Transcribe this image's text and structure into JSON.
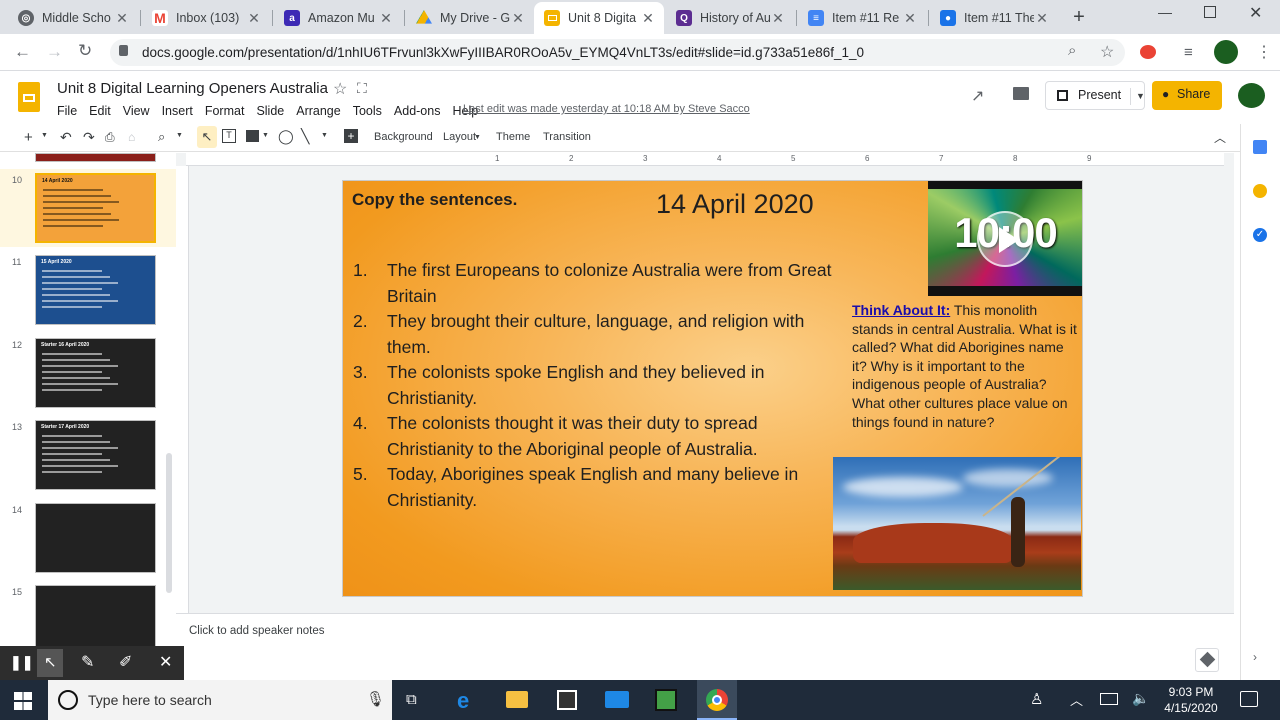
{
  "tabs": [
    {
      "label": "Middle Scho",
      "color": "#5f6368"
    },
    {
      "label": "Inbox (103)",
      "color": "#ea4335"
    },
    {
      "label": "Amazon Mu",
      "color": "#3d2ab5"
    },
    {
      "label": "My Drive - G",
      "color": "#1a73e8"
    },
    {
      "label": "Unit 8 Digita",
      "color": "#f4b400"
    },
    {
      "label": "History of Au",
      "color": "#5c2d91"
    },
    {
      "label": "Item #11 Re",
      "color": "#4285f4"
    },
    {
      "label": "Item #11 The",
      "color": "#1a73e8"
    }
  ],
  "browser": {
    "url": "docs.google.com/presentation/d/1nhIU6TFrvunl3kXwFyIIIBAR0ROoA5v_EYMQ4VnLT3s/edit#slide=id.g733a51e86f_1_0"
  },
  "doc": {
    "title": "Unit 8 Digital Learning Openers Australia",
    "menu": [
      "File",
      "Edit",
      "View",
      "Insert",
      "Format",
      "Slide",
      "Arrange",
      "Tools",
      "Add-ons",
      "Help"
    ],
    "last_edit": "Last edit was made yesterday at 10:18 AM by Steve Sacco",
    "present_label": "Present",
    "share_label": "Share"
  },
  "toolbar": {
    "background": "Background",
    "layout": "Layout",
    "theme": "Theme",
    "transition": "Transition"
  },
  "ruler": [
    "1",
    "2",
    "3",
    "4",
    "5",
    "6",
    "7",
    "8",
    "9"
  ],
  "filmstrip": {
    "slides": [
      {
        "num": "10",
        "title": "14 April 2020",
        "bg": "#f3a23a",
        "selected": true
      },
      {
        "num": "11",
        "title": "15 April 2020",
        "bg": "#1d4f8f",
        "selected": false
      },
      {
        "num": "12",
        "title": "Starter 16 April 2020",
        "bg": "#222222",
        "selected": false
      },
      {
        "num": "13",
        "title": "Starter 17 April 2020",
        "bg": "#222222",
        "selected": false
      },
      {
        "num": "14",
        "title": "",
        "bg": "#222222",
        "selected": false
      },
      {
        "num": "15",
        "title": "",
        "bg": "#222222",
        "selected": false
      }
    ]
  },
  "slide": {
    "heading": "Copy the sentences.",
    "date": "14 April 2020",
    "video_label": "10:00",
    "items": [
      {
        "num": "1.",
        "text": "The first Europeans to colonize Australia were from Great Britain"
      },
      {
        "num": "2.",
        "text": "They brought their culture, language, and religion with them."
      },
      {
        "num": "3.",
        "text": "The colonists spoke English and they believed in Christianity."
      },
      {
        "num": "4.",
        "text": "The colonists thought it was their duty to spread Christianity to the Aboriginal people of Australia."
      },
      {
        "num": "5.",
        "text": "Today, Aborigines speak English and many believe in Christianity."
      }
    ],
    "think_link": "Think About It:",
    "think_text": " This monolith stands in central Australia. What is it called? What did Aborigines name it? Why is it important to the indigenous people of Australia? What other cultures place value on things found in nature?"
  },
  "notes_placeholder": "Click to add speaker notes",
  "taskbar": {
    "search_placeholder": "Type here to search",
    "time": "9:03 PM",
    "date": "4/15/2020"
  },
  "colors": {
    "accent": "#f4b400",
    "link": "#1a0dab",
    "slide_orange": "#f29a1f"
  }
}
